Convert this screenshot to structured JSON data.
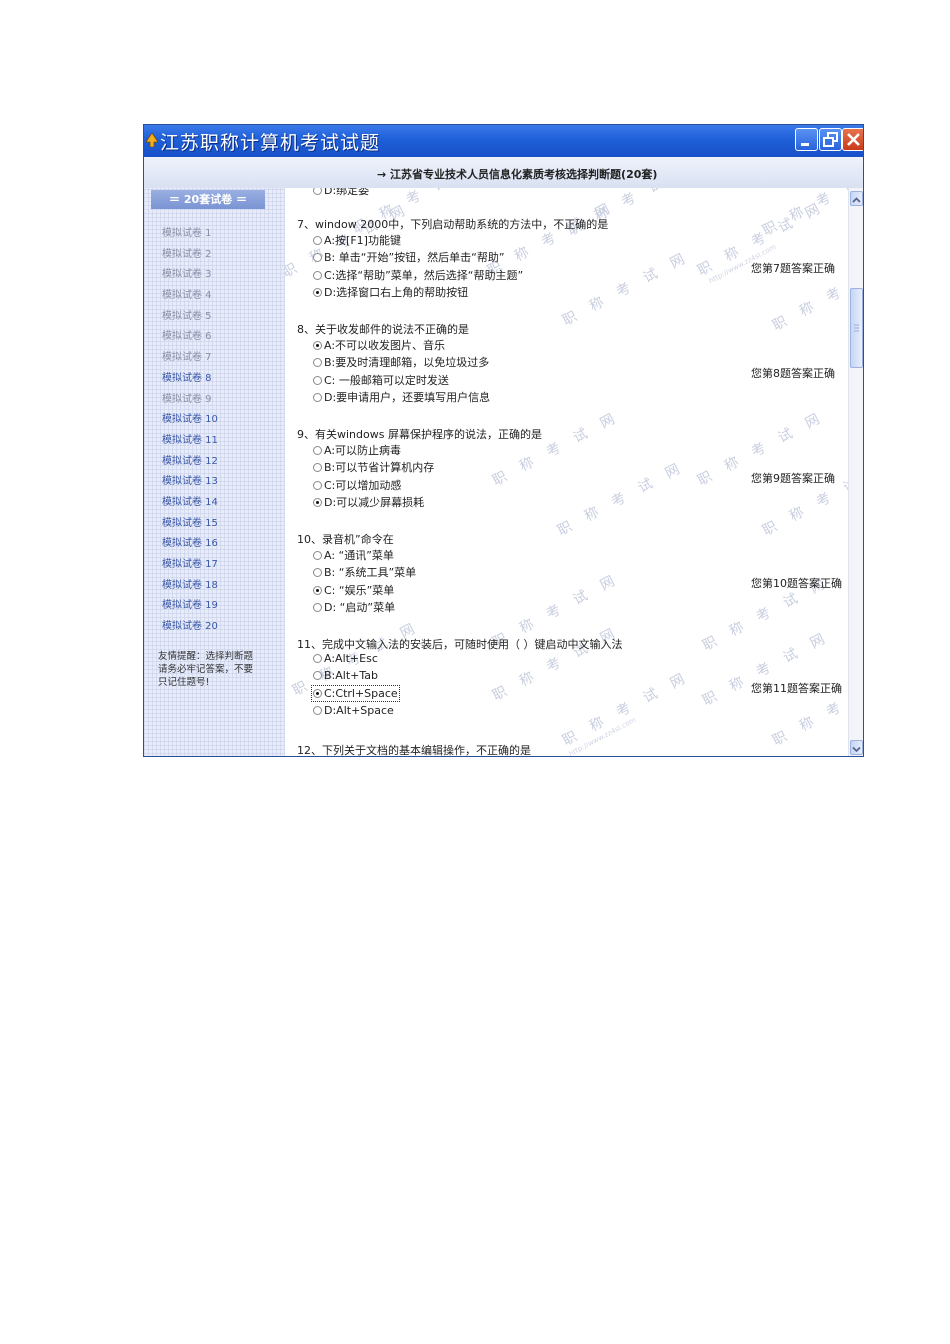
{
  "window": {
    "title": "江苏职称计算机考试试题",
    "header": "→ 江苏省专业技术人员信息化素质考核选择判断题(20套)"
  },
  "sidebar": {
    "heading": "＝ 20套试卷 ＝",
    "items": [
      {
        "label": "模拟试卷 1"
      },
      {
        "label": "模拟试卷 2"
      },
      {
        "label": "模拟试卷 3"
      },
      {
        "label": "模拟试卷 4"
      },
      {
        "label": "模拟试卷 5"
      },
      {
        "label": "模拟试卷 6"
      },
      {
        "label": "模拟试卷 7"
      },
      {
        "label": "模拟试卷 8"
      },
      {
        "label": "模拟试卷 9"
      },
      {
        "label": "模拟试卷 10"
      },
      {
        "label": "模拟试卷 11"
      },
      {
        "label": "模拟试卷 12"
      },
      {
        "label": "模拟试卷 13"
      },
      {
        "label": "模拟试卷 14"
      },
      {
        "label": "模拟试卷 15"
      },
      {
        "label": "模拟试卷 16"
      },
      {
        "label": "模拟试卷 17"
      },
      {
        "label": "模拟试卷 18"
      },
      {
        "label": "模拟试卷 19"
      },
      {
        "label": "模拟试卷 20"
      }
    ],
    "tip": "友情提醒：选择判断题请务必牢记答案，不要只记住题号!"
  },
  "questions": [
    {
      "text": "7、window 2000中，下列启动帮助系统的方法中，不正确的是",
      "options": [
        "A:按[F1]功能键",
        "B: 单击“开始”按钮，然后单击“帮助”",
        "C:选择“帮助”菜单，然后选择“帮助主题”",
        "D:选择窗口右上角的帮助按钮"
      ],
      "status": "您第7题答案正确"
    },
    {
      "text": "8、关于收发邮件的说法不正确的是",
      "options": [
        "A:不可以收发图片、音乐",
        "B:要及时清理邮箱，以免垃圾过多",
        "C: 一般邮箱可以定时发送",
        "D:要申请用户，还要填写用户信息"
      ],
      "status": "您第8题答案正确"
    },
    {
      "text": "9、有关windows 屏幕保护程序的说法，正确的是",
      "options": [
        "A:可以防止病毒",
        "B:可以节省计算机内存",
        "C:可以增加动感",
        "D:可以减少屏幕损耗"
      ],
      "status": "您第9题答案正确"
    },
    {
      "text": "10、录音机”命令在",
      "options": [
        "A: “通讯”菜单",
        "B: “系统工具”菜单",
        "C: “娱乐”菜单",
        "D: “启动”菜单"
      ],
      "status": "您第10题答案正确"
    },
    {
      "text": "11、完成中文输入法的安装后，可随时使用（ ）键启动中文输入法",
      "options": [
        "A:Alt+Esc",
        "B:Alt+Tab",
        "C:Ctrl+Space",
        "D:Alt+Space"
      ],
      "status": "您第11题答案正确"
    }
  ],
  "partial": {
    "top_option": "D:绑定委",
    "bottom_question": "12、下列关于文档的基本编辑操作，不正确的是"
  },
  "watermark": {
    "text": "职 称 考 试 网",
    "url": "http://www.zz4sl.com"
  }
}
